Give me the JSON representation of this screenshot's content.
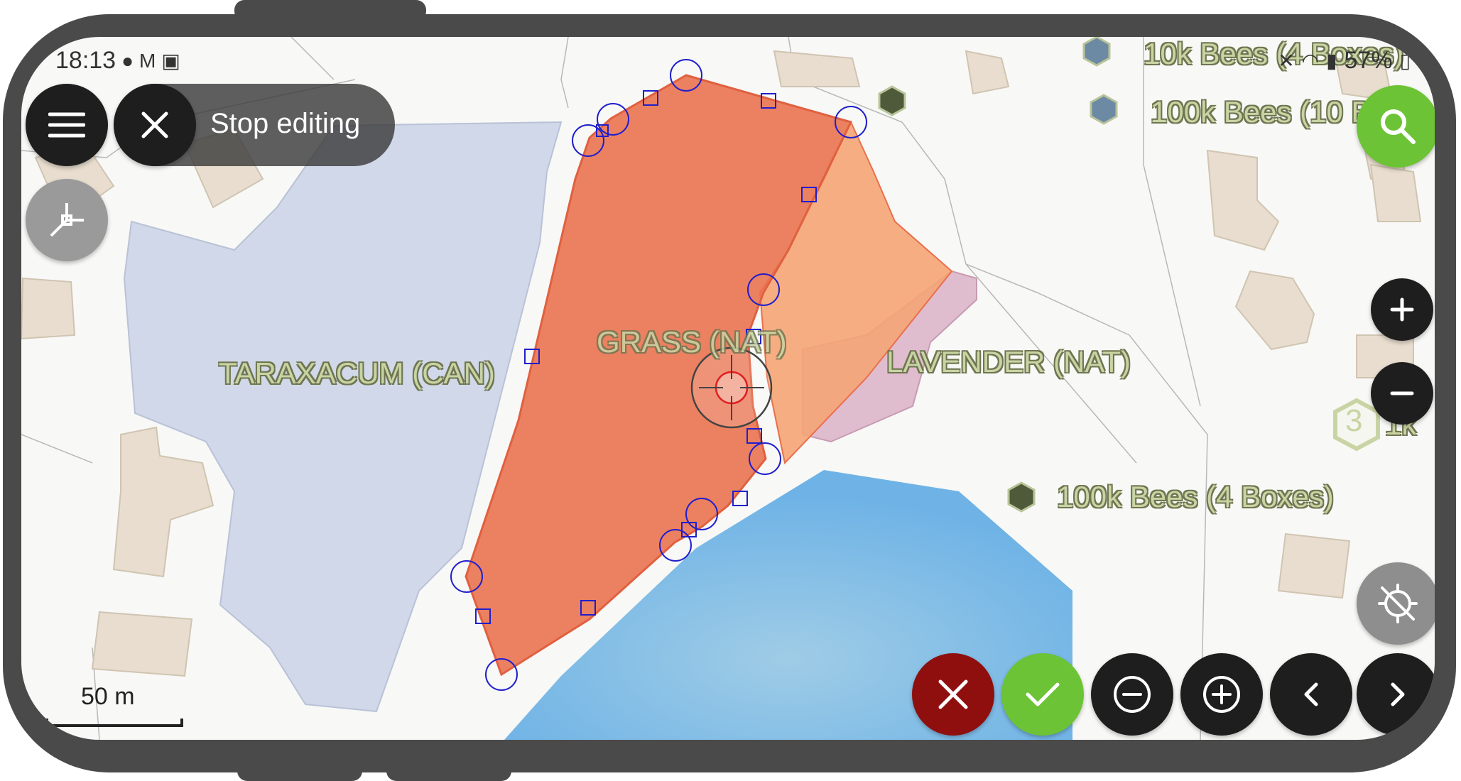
{
  "status_bar": {
    "time": "18:13",
    "battery": "57%"
  },
  "editing": {
    "stop_label": "Stop editing"
  },
  "map_labels": {
    "taraxacum": "TARAXACUM (CAN)",
    "grass": "GRASS (NAT)",
    "lavender": "LAVENDER (NAT)",
    "hive_1": "10k Bees (4 Boxes)",
    "hive_2": "100k Bees (10 B",
    "hive_3": "100k Bees (4 Boxes)",
    "cluster_count": "3",
    "cluster_label": "1k"
  },
  "scale_bar": {
    "label": "50 m"
  },
  "colors": {
    "accent_green": "#6cc335",
    "cancel_red": "#8f0f0f",
    "edit_polygon": "#e8704c",
    "water": "#72b6e6",
    "lavender": "#dcb2c8",
    "taraxacum": "#c9d2e6"
  },
  "icons": [
    "menu-icon",
    "close-icon",
    "vertex-icon",
    "search-icon",
    "plus-icon",
    "minus-icon",
    "gps-off-icon",
    "remove-vertex-icon",
    "add-vertex-icon",
    "chevron-left-icon",
    "chevron-right-icon",
    "check-icon",
    "hive-icon"
  ]
}
